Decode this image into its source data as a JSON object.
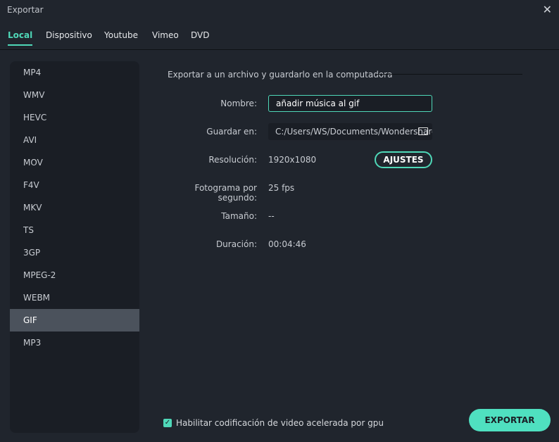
{
  "window": {
    "title": "Exportar",
    "close_icon": "close-icon"
  },
  "tabs": [
    {
      "label": "Local",
      "active": true
    },
    {
      "label": "Dispositivo"
    },
    {
      "label": "Youtube"
    },
    {
      "label": "Vimeo"
    },
    {
      "label": "DVD"
    }
  ],
  "formats": [
    "MP4",
    "WMV",
    "HEVC",
    "AVI",
    "MOV",
    "F4V",
    "MKV",
    "TS",
    "3GP",
    "MPEG-2",
    "WEBM",
    "GIF",
    "MP3"
  ],
  "selected_format": "GIF",
  "main": {
    "section_title": "Exportar a un archivo y guardarlo en la computadora",
    "name_label": "Nombre:",
    "name_value": "añadir música al gif",
    "save_label": "Guardar en:",
    "save_value": "C:/Users/WS/Documents/Wondershare",
    "res_label": "Resolución:",
    "res_value": "1920x1080",
    "settings_button": "AJUSTES",
    "fps_label": "Fotograma por segundo:",
    "fps_value": "25 fps",
    "size_label": "Tamaño:",
    "size_value": "--",
    "dur_label": "Duración:",
    "dur_value": "00:04:46"
  },
  "gpu": {
    "label": "Habilitar codificación de video acelerada por gpu",
    "checked": true
  },
  "export_button": "EXPORTAR",
  "colors": {
    "accent": "#4fd8b8",
    "background": "#20252d",
    "panel": "#1a1e25",
    "selected": "#4b525c"
  }
}
